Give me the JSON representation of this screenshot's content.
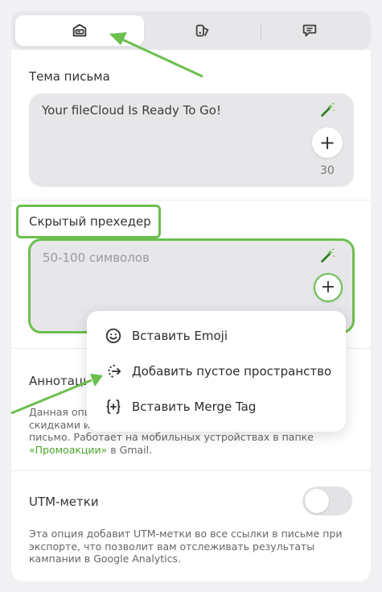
{
  "tabs": [
    {
      "name": "email-settings",
      "icon": "envelope-card-icon",
      "active": true
    },
    {
      "name": "design",
      "icon": "palette-icon",
      "active": false
    },
    {
      "name": "comments",
      "icon": "chat-bubble-icon",
      "active": false
    }
  ],
  "subject": {
    "label": "Тема письма",
    "value": "Your fileCloud Is Ready To Go!",
    "counter": "30"
  },
  "preheader": {
    "label": "Скрытый прехедер",
    "placeholder": "50-100 символов"
  },
  "annotation": {
    "label": "Аннотаци",
    "desc_line1": "Данная опц",
    "desc_line2": "скидками и",
    "desc_line3": "письмо. Работает на мобильных устройствах в папке",
    "desc_link": "«Промоакции»",
    "desc_suffix": " в Gmail."
  },
  "utm": {
    "label": "UTM-метки",
    "enabled": false,
    "desc": "Эта опция добавит UTM-метки во все ссылки в письме при экспорте, что позволит вам отслеживать результаты кампании в Google Analytics."
  },
  "menu": {
    "items": [
      {
        "label": "Вставить Emoji",
        "icon": "emoji-icon"
      },
      {
        "label": "Добавить пустое пространство",
        "icon": "space-arrow-icon"
      },
      {
        "label": "Вставить Merge Tag",
        "icon": "merge-tag-icon"
      }
    ]
  },
  "colors": {
    "accent_green": "#6bbf4e",
    "field_bg": "#e7e7ea",
    "link_green": "#4aa52b"
  }
}
